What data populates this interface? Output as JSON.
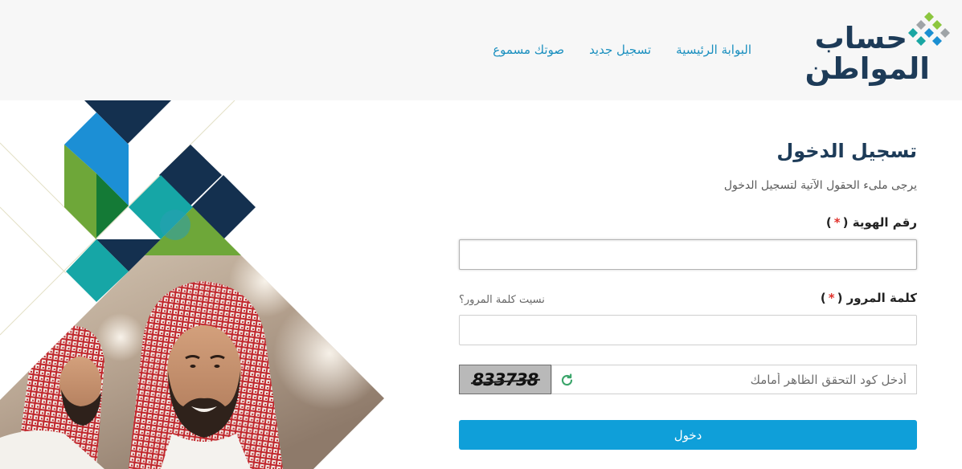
{
  "header": {
    "logo": {
      "line1": "حساب",
      "line2": "المواطن"
    },
    "nav": [
      {
        "label": "البوابة الرئيسية"
      },
      {
        "label": "تسجيل جديد"
      },
      {
        "label": "صوتك مسموع"
      }
    ]
  },
  "login": {
    "title": "تسجيل الدخول",
    "subtitle": "يرجى ملىء الحقول الآتية لتسجيل الدخول",
    "required": {
      "open": "(",
      "mark": "*",
      "close": ")"
    },
    "id_field": {
      "label": "رقم الهوية",
      "value": ""
    },
    "password_field": {
      "label": "كلمة المرور",
      "value": "",
      "forgot_link": "نسيت كلمة المرور؟"
    },
    "captcha": {
      "code": "833738",
      "placeholder": "أدخل كود التحقق الظاهر أمامك"
    },
    "submit_label": "دخول"
  },
  "icons": {
    "logo_emblem": "logo-emblem-icon",
    "refresh": "refresh-icon"
  },
  "colors": {
    "brand_navy": "#1d3b58",
    "nav_link": "#1a8fbf",
    "required": "#e0312b",
    "button": "#0f9fd9",
    "refresh_icon": "#3aa56a",
    "header_bg": "#f7f7f7"
  }
}
